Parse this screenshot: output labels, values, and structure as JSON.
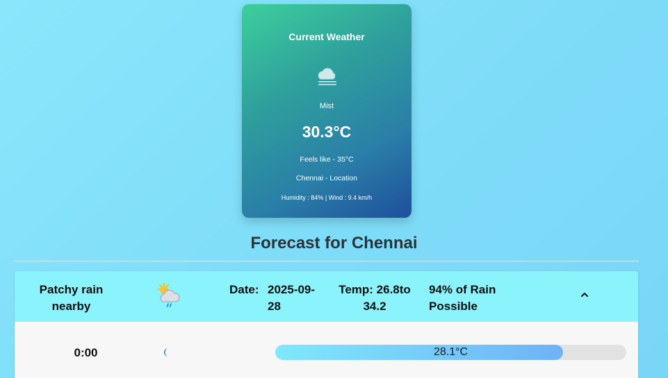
{
  "current": {
    "title": "Current Weather",
    "icon": "mist-cloud-icon",
    "condition": "Mist",
    "temperature": "30.3°C",
    "feels_like": "Feels like - 35°C",
    "location": "Chennai - Location",
    "meta": "Humidity : 84% | Wind : 9.4 km/h"
  },
  "forecast": {
    "title": "Forecast for Chennai",
    "days": [
      {
        "condition": "Patchy rain nearby",
        "icon": "patchy-rain-icon",
        "date_label": "Date:",
        "date_value": "2025-09-28",
        "temp": "Temp: 26.8to 34.2",
        "rain": "94% of Rain Possible",
        "toggle_icon": "chevron-up-icon",
        "hours": [
          {
            "time": "0:00",
            "icon": "crescent-moon-icon",
            "temp_label": "28.1°C",
            "fill_fraction": 0.82
          }
        ]
      }
    ]
  },
  "colors": {
    "background": "#8ae6fb",
    "card_gradient_start": "#3dcf9c",
    "card_gradient_end": "#1f4f9c",
    "day_header": "#8af3fb",
    "bar_fill_start": "#7fe8fb",
    "bar_fill_end": "#6fb2f6"
  }
}
